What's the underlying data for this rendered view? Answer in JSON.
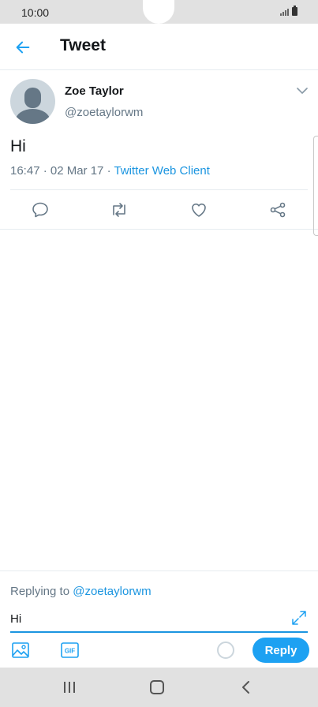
{
  "status": {
    "time": "10:00"
  },
  "header": {
    "title": "Tweet"
  },
  "tweet": {
    "name": "Zoe Taylor",
    "handle": "@zoetaylorwm",
    "text": "Hi",
    "datetime": "16:47 · 02 Mar 17 · ",
    "source": "Twitter Web Client"
  },
  "composer": {
    "replying_prefix": "Replying to ",
    "mention": "@zoetaylorwm",
    "input_value": "Hi",
    "reply_label": "Reply",
    "gif_label": "GIF"
  },
  "colors": {
    "accent": "#1da1f2",
    "link": "#1b95e0",
    "muted": "#657786",
    "system_bar": "#e1e1e1"
  },
  "icons": {
    "back": "arrow-left-icon",
    "caret": "chevron-down-icon",
    "reply": "comment-icon",
    "retweet": "retweet-icon",
    "like": "heart-icon",
    "share": "share-icon",
    "expand": "expand-icon",
    "media": "image-icon",
    "gif": "gif-icon",
    "nav_recents": "recents-icon",
    "nav_home": "home-icon",
    "nav_back": "nav-back-icon"
  }
}
